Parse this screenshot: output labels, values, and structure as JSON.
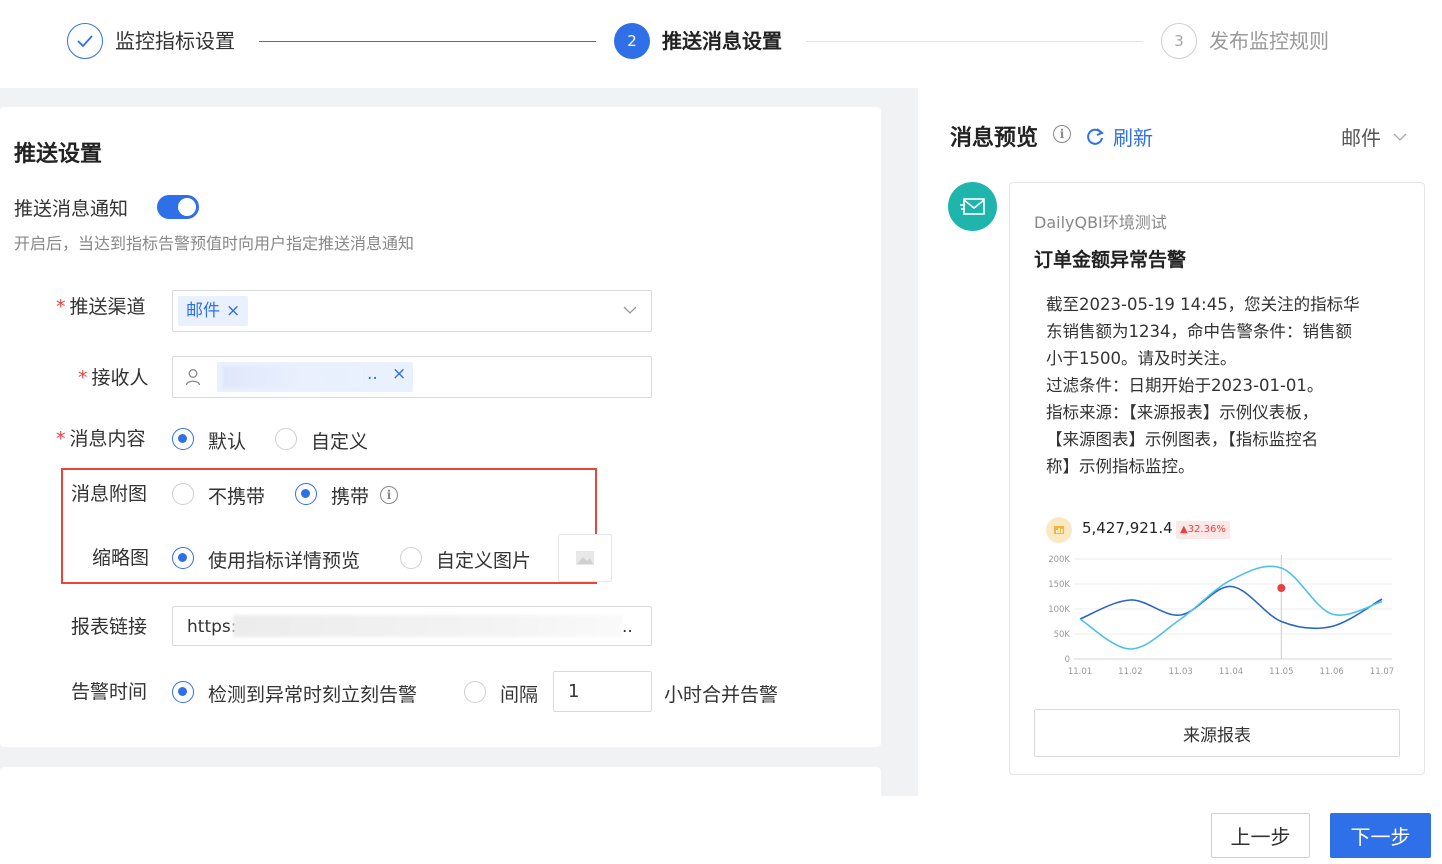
{
  "steps": [
    {
      "number": "1",
      "label": "监控指标设置",
      "state": "done"
    },
    {
      "number": "2",
      "label": "推送消息设置",
      "state": "active"
    },
    {
      "number": "3",
      "label": "发布监控规则",
      "state": "todo"
    }
  ],
  "form": {
    "section_title": "推送设置",
    "notify_label": "推送消息通知",
    "notify_enabled": true,
    "notify_hint": "开启后，当达到指标告警预值时向用户指定推送消息通知",
    "channel_label": "推送渠道",
    "channel_tag": "邮件",
    "tag_remove": "×",
    "recipient_label": "接收人",
    "recipient_ellipsis": "..",
    "content_label": "消息内容",
    "content_options": [
      "默认",
      "自定义"
    ],
    "content_selected": "默认",
    "attach_label": "消息附图",
    "attach_options": [
      "不携带",
      "携带"
    ],
    "attach_selected": "携带",
    "thumb_label": "缩略图",
    "thumb_options": [
      "使用指标详情预览",
      "自定义图片"
    ],
    "thumb_selected": "使用指标详情预览",
    "link_label": "报表链接",
    "link_prefix": "https:",
    "link_ellipsis": "..",
    "alert_time_label": "告警时间",
    "alert_options": [
      "检测到异常时刻立刻告警",
      "间隔"
    ],
    "alert_selected": "检测到异常时刻立刻告警",
    "interval_value": "1",
    "interval_suffix": "小时合并告警"
  },
  "preview": {
    "title": "消息预览",
    "refresh_label": "刷新",
    "channel": "邮件",
    "source_name": "DailyQBI环境测试",
    "message_title": "订单金额异常告警",
    "body_lines": [
      "截至2023-05-19 14:45，您关注的指标华",
      "东销售额为1234，命中告警条件：销售额",
      "小于1500。请及时关注。",
      "过滤条件：日期开始于2023-01-01。",
      "指标来源：【来源报表】示例仪表板，",
      "【来源图表】示例图表，【指标监控名",
      "称】示例指标监控。"
    ],
    "kpi_value": "5,427,921.4",
    "kpi_change": "▲32.36%",
    "source_button": "来源报表"
  },
  "chart_data": {
    "type": "line",
    "categories": [
      "11.01",
      "11.02",
      "11.03",
      "11.04",
      "11.05",
      "11.06",
      "11.07"
    ],
    "y_ticks": [
      "200K",
      "150K",
      "100K",
      "50K",
      "0"
    ],
    "ylim": [
      0,
      200000
    ],
    "series": [
      {
        "values": [
          80000,
          118000,
          88000,
          145000,
          75000,
          65000,
          120000
        ],
        "color": "#2a65c6"
      },
      {
        "values": [
          80000,
          20000,
          80000,
          158000,
          182000,
          90000,
          115000
        ],
        "color": "#4cc2e8"
      }
    ],
    "highlight": {
      "x": "11.05",
      "y": 142000
    }
  },
  "footer": {
    "prev": "上一步",
    "next": "下一步"
  },
  "colors": {
    "accent": "#2f6fe8",
    "highlight_border": "#e8463a",
    "avatar": "#1fb5ac"
  }
}
